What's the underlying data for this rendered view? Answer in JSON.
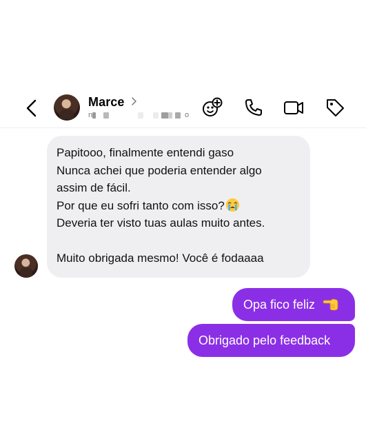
{
  "header": {
    "contact_name": "Marce",
    "subtitle_partial_start": "n",
    "subtitle_partial_end": "o",
    "icons": {
      "back": "chevron-left-icon",
      "name_chevron": "chevron-right-icon",
      "effects": "sparkle-effects-icon",
      "call": "phone-icon",
      "video": "video-camera-icon",
      "tag": "tag-icon"
    }
  },
  "conversation": {
    "incoming": {
      "lines": [
        "Papitooo, finalmente entendi gaso",
        "Nunca achei que poderia entender algo",
        "assim de fácil.",
        "Por que eu sofri tanto com isso?",
        "Deveria ter visto tuas aulas muito antes.",
        "",
        "Muito obrigada mesmo! Você é fodaaaa"
      ],
      "emoji": "loudly-crying-face"
    },
    "outgoing": [
      {
        "text": "Opa fico feliz",
        "emoji": "backhand-index-pointing-left"
      },
      {
        "text": "Obrigado pelo feedback"
      }
    ]
  },
  "colors": {
    "outgoing_bubble": "#8b2fe6",
    "incoming_bubble": "#efeff1"
  }
}
